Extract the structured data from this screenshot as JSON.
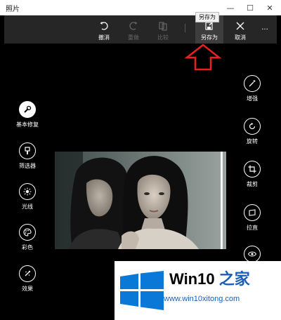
{
  "window": {
    "title": "照片",
    "controls": {
      "minimize": "—",
      "maximize": "☐",
      "close": "✕"
    }
  },
  "toolbar": {
    "undo": "撤消",
    "redo": "重做",
    "compare": "比较",
    "save_as": "另存为",
    "cancel": "取消",
    "more": "···",
    "tooltip": "另存为"
  },
  "left_tools": [
    {
      "label": "基本修复",
      "icon": "wrench-icon",
      "selected": true
    },
    {
      "label": "筛选器",
      "icon": "filter-icon",
      "selected": false
    },
    {
      "label": "光线",
      "icon": "sun-icon",
      "selected": false
    },
    {
      "label": "彩色",
      "icon": "palette-icon",
      "selected": false
    },
    {
      "label": "效果",
      "icon": "effects-icon",
      "selected": false
    }
  ],
  "right_tools": [
    {
      "label": "增强",
      "icon": "magic-wand-icon"
    },
    {
      "label": "旋转",
      "icon": "rotate-icon"
    },
    {
      "label": "裁剪",
      "icon": "crop-icon"
    },
    {
      "label": "拉直",
      "icon": "straighten-icon"
    },
    {
      "label": "",
      "icon": "red-eye-icon"
    }
  ],
  "watermark": {
    "title_a": "Win10 ",
    "title_b": "之家",
    "url": "www.win10xitong.com"
  },
  "colors": {
    "arrow": "#e8211e",
    "watermark_blue": "#1a5fb4",
    "toolbar_bg": "#262626"
  }
}
